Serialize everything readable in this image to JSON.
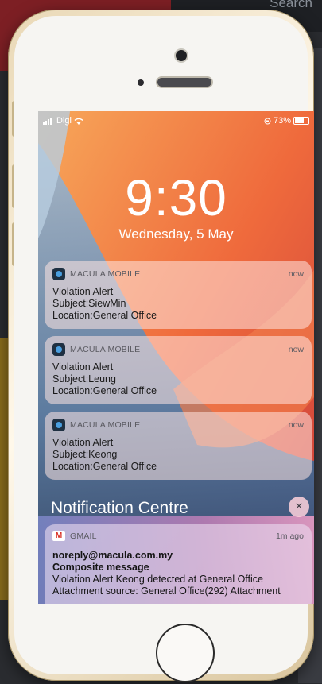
{
  "background": {
    "search_label": "Search"
  },
  "status_bar": {
    "carrier": "Digi",
    "battery": "73%"
  },
  "lock_screen": {
    "time": "9:30",
    "date": "Wednesday, 5 May"
  },
  "notifications": [
    {
      "app": "MACULA MOBILE",
      "when": "now",
      "title": "Violation Alert",
      "subject": "Subject:SiewMin",
      "location": "Location:General Office"
    },
    {
      "app": "MACULA MOBILE",
      "when": "now",
      "title": "Violation Alert",
      "subject": "Subject:Leung",
      "location": "Location:General Office"
    },
    {
      "app": "MACULA MOBILE",
      "when": "now",
      "title": "Violation Alert",
      "subject": "Subject:Keong",
      "location": "Location:General Office"
    }
  ],
  "notification_centre": {
    "title": "Notification Centre",
    "close_symbol": "×",
    "gmail": {
      "app": "GMAIL",
      "when": "1m ago",
      "from": "noreply@macula.com.my",
      "subject": "Composite message",
      "line1": "Violation Alert Keong detected at General Office",
      "line2": "Attachment source: General Office(292) Attachment"
    }
  },
  "colors": {
    "accent_red": "#7d1f24",
    "gold_strip": "#8a6d1c",
    "phone_body": "#f6f5f2"
  }
}
